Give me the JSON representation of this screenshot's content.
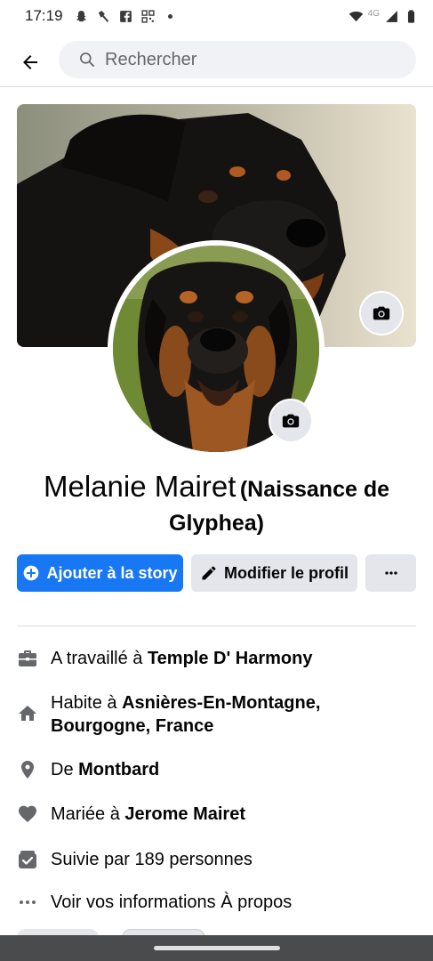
{
  "status_bar": {
    "time": "17:19",
    "left_icons": [
      "snapchat-icon",
      "hammer-icon",
      "facebook-icon",
      "qr-icon"
    ],
    "network": "4G",
    "right_icons": [
      "wifi-icon",
      "signal-icon",
      "battery-icon"
    ]
  },
  "header": {
    "back_icon": "arrow-left-icon",
    "search_placeholder": "Rechercher"
  },
  "profile": {
    "name": "Melanie Mairet",
    "alt_name": "(Naissance de Glyphea)"
  },
  "actions": {
    "add_story": "Ajouter à la story",
    "edit_profile": "Modifier le profil",
    "more": "…"
  },
  "details": [
    {
      "icon": "briefcase-icon",
      "prefix": "A travaillé à ",
      "bold": "Temple D' Harmony"
    },
    {
      "icon": "home-icon",
      "prefix": "Habite à ",
      "bold": "Asnières-En-Montagne, Bourgogne, France"
    },
    {
      "icon": "location-pin-icon",
      "prefix": "De ",
      "bold": "Montbard"
    },
    {
      "icon": "heart-icon",
      "prefix": "Mariée à ",
      "bold": "Jerome Mairet"
    },
    {
      "icon": "followers-icon",
      "prefix": "Suivie par 189 personnes",
      "bold": ""
    },
    {
      "icon": "more-dots-icon",
      "prefix": "Voir vos informations À propos",
      "bold": ""
    }
  ],
  "colors": {
    "accent": "#1877f2",
    "secondary_button": "#e4e6eb",
    "text": "#050505",
    "muted": "#65676b"
  }
}
